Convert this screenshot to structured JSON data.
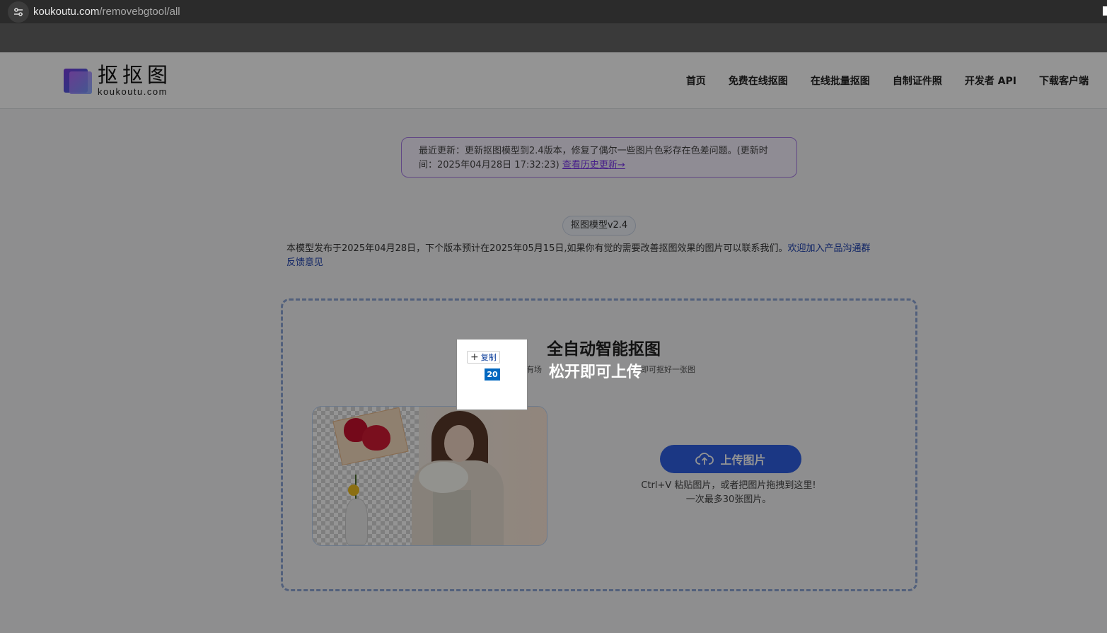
{
  "browser": {
    "url_host": "koukoutu.com",
    "url_path": "/removebgtool/all",
    "site_info_icon": "tune-icon"
  },
  "header": {
    "logo_cn": "抠抠图",
    "logo_en": "koukoutu.com",
    "nav": [
      "首页",
      "免费在线抠图",
      "在线批量抠图",
      "自制证件照",
      "开发者 API",
      "下载客户端"
    ]
  },
  "notice": {
    "text": "最近更新：更新抠图模型到2.4版本，修复了偶尔一些图片色彩存在色差问题。(更新时间：2025年04月28日 17:32:23)",
    "link": "查看历史更新→",
    "border_color": "#a77ae6"
  },
  "model": {
    "badge": "抠图模型v2.4",
    "desc": "本模型发布于2025年04月28日，下个版本预计在2025年05月15日,如果你有觉的需要改善抠图效果的图片可以联系我们。",
    "link1": "欢迎加入产品沟通群",
    "link2": "反馈意见"
  },
  "upload": {
    "title": "全自动智能抠图",
    "subtitle_visible": "有场",
    "subtitle_tail": "即可抠好一张图",
    "button": "上传图片",
    "button_icon": "cloud-upload-icon",
    "hint_line1": "Ctrl+V 粘贴图片，或者把图片拖拽到这里!",
    "hint_line2": "一次最多30张图片。",
    "accent": "#2f5fe3"
  },
  "overlay": {
    "drop_text": "松开即可上传"
  },
  "drag": {
    "copy_label": "复制",
    "count": "20"
  }
}
